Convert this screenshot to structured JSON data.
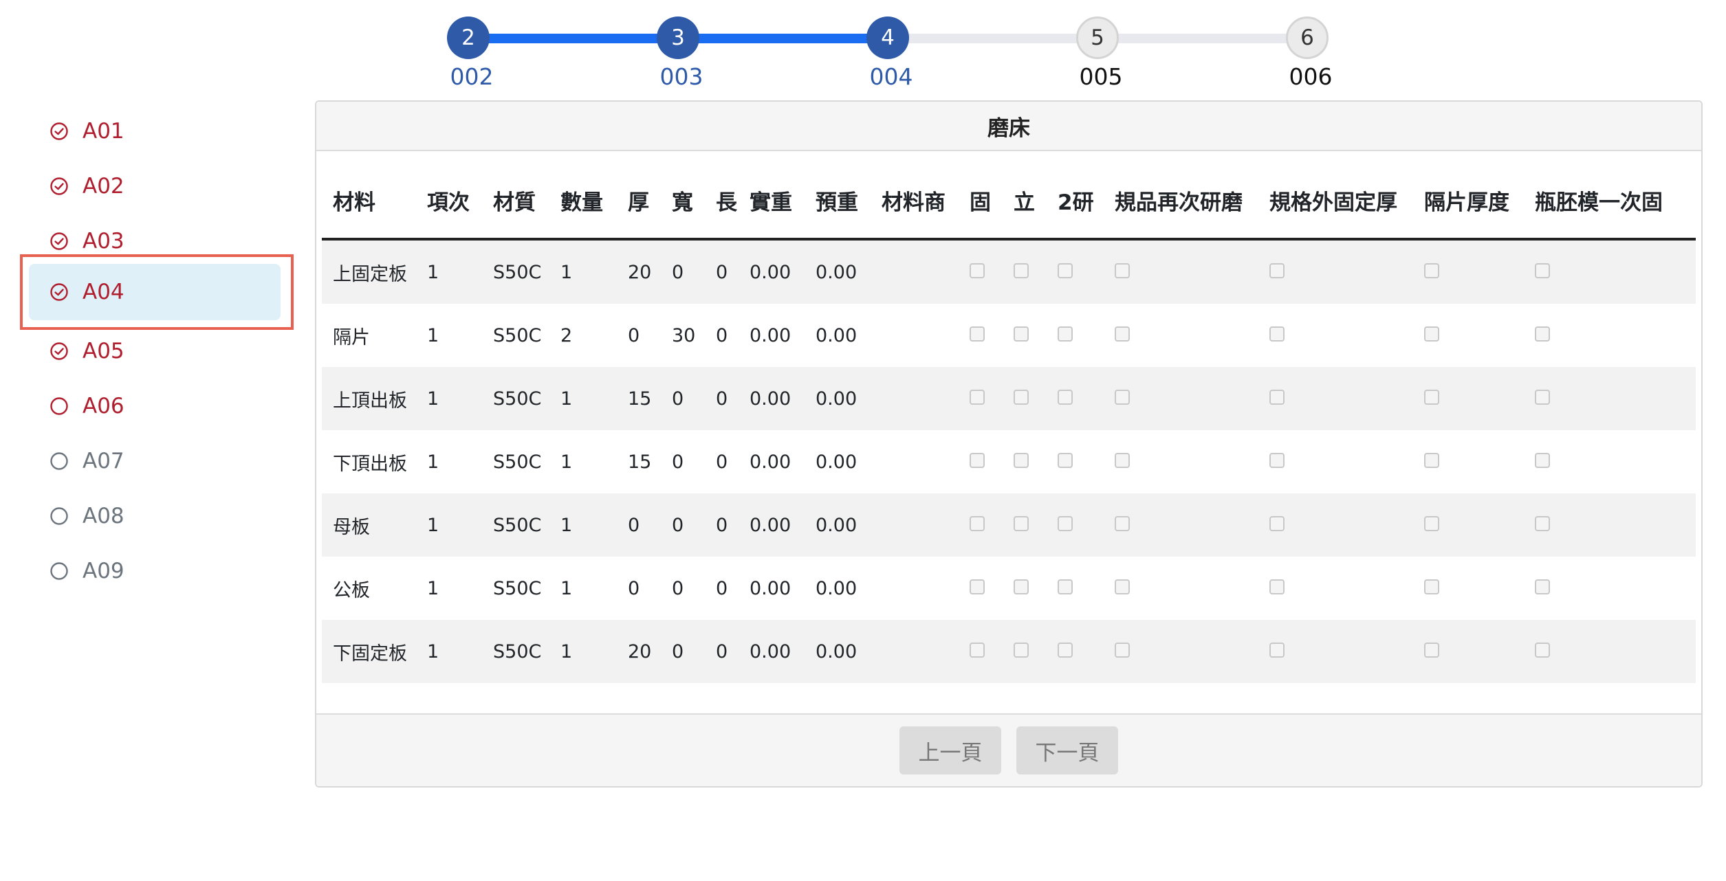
{
  "stepper": {
    "steps": [
      {
        "number": "2",
        "label": "002",
        "state": "active"
      },
      {
        "number": "3",
        "label": "003",
        "state": "active"
      },
      {
        "number": "4",
        "label": "004",
        "state": "active"
      },
      {
        "number": "5",
        "label": "005",
        "state": "pending"
      },
      {
        "number": "6",
        "label": "006",
        "state": "pending"
      }
    ],
    "colors": {
      "done_line": "#1a6cf0",
      "active_circle": "#2f5aa8",
      "todo_line": "#e8e9ee"
    }
  },
  "sidebar": {
    "items": [
      {
        "label": "A01",
        "status": "done",
        "icon": "check-circle-icon"
      },
      {
        "label": "A02",
        "status": "done",
        "icon": "check-circle-icon"
      },
      {
        "label": "A03",
        "status": "done",
        "icon": "check-circle-icon"
      },
      {
        "label": "A04",
        "status": "done",
        "icon": "check-circle-icon",
        "selected": true
      },
      {
        "label": "A05",
        "status": "done",
        "icon": "check-circle-icon"
      },
      {
        "label": "A06",
        "status": "current",
        "icon": "circle-icon"
      },
      {
        "label": "A07",
        "status": "todo",
        "icon": "circle-icon"
      },
      {
        "label": "A08",
        "status": "todo",
        "icon": "circle-icon"
      },
      {
        "label": "A09",
        "status": "todo",
        "icon": "circle-icon"
      }
    ],
    "colors": {
      "done": "#b01e2e",
      "todo": "#6c757d",
      "selected_bg": "#dff0f8",
      "highlight": "#e8604f"
    }
  },
  "card": {
    "title": "磨床",
    "columns": [
      "材料",
      "項次",
      "材質",
      "數量",
      "厚",
      "寬",
      "長",
      "實重",
      "預重",
      "材料商",
      "固",
      "立",
      "2研",
      "規品再次研磨",
      "規格外固定厚",
      "隔片厚度",
      "瓶胚模一次固"
    ],
    "rows": [
      {
        "material": "上固定板",
        "item": "1",
        "grade": "S50C",
        "qty": "1",
        "thick": "20",
        "width": "0",
        "length": "0",
        "actual_weight": "0.00",
        "est_weight": "0.00",
        "supplier": "",
        "checks": [
          false,
          false,
          false,
          false,
          false,
          false,
          false
        ]
      },
      {
        "material": "隔片",
        "item": "1",
        "grade": "S50C",
        "qty": "2",
        "thick": "0",
        "width": "30",
        "length": "0",
        "actual_weight": "0.00",
        "est_weight": "0.00",
        "supplier": "",
        "checks": [
          false,
          false,
          false,
          false,
          false,
          false,
          false
        ]
      },
      {
        "material": "上頂出板",
        "item": "1",
        "grade": "S50C",
        "qty": "1",
        "thick": "15",
        "width": "0",
        "length": "0",
        "actual_weight": "0.00",
        "est_weight": "0.00",
        "supplier": "",
        "checks": [
          false,
          false,
          false,
          false,
          false,
          false,
          false
        ]
      },
      {
        "material": "下頂出板",
        "item": "1",
        "grade": "S50C",
        "qty": "1",
        "thick": "15",
        "width": "0",
        "length": "0",
        "actual_weight": "0.00",
        "est_weight": "0.00",
        "supplier": "",
        "checks": [
          false,
          false,
          false,
          false,
          false,
          false,
          false
        ]
      },
      {
        "material": "母板",
        "item": "1",
        "grade": "S50C",
        "qty": "1",
        "thick": "0",
        "width": "0",
        "length": "0",
        "actual_weight": "0.00",
        "est_weight": "0.00",
        "supplier": "",
        "checks": [
          false,
          false,
          false,
          false,
          false,
          false,
          false
        ]
      },
      {
        "material": "公板",
        "item": "1",
        "grade": "S50C",
        "qty": "1",
        "thick": "0",
        "width": "0",
        "length": "0",
        "actual_weight": "0.00",
        "est_weight": "0.00",
        "supplier": "",
        "checks": [
          false,
          false,
          false,
          false,
          false,
          false,
          false
        ]
      },
      {
        "material": "下固定板",
        "item": "1",
        "grade": "S50C",
        "qty": "1",
        "thick": "20",
        "width": "0",
        "length": "0",
        "actual_weight": "0.00",
        "est_weight": "0.00",
        "supplier": "",
        "checks": [
          false,
          false,
          false,
          false,
          false,
          false,
          false
        ]
      }
    ]
  },
  "pager": {
    "prev_label": "上一頁",
    "next_label": "下一頁"
  }
}
